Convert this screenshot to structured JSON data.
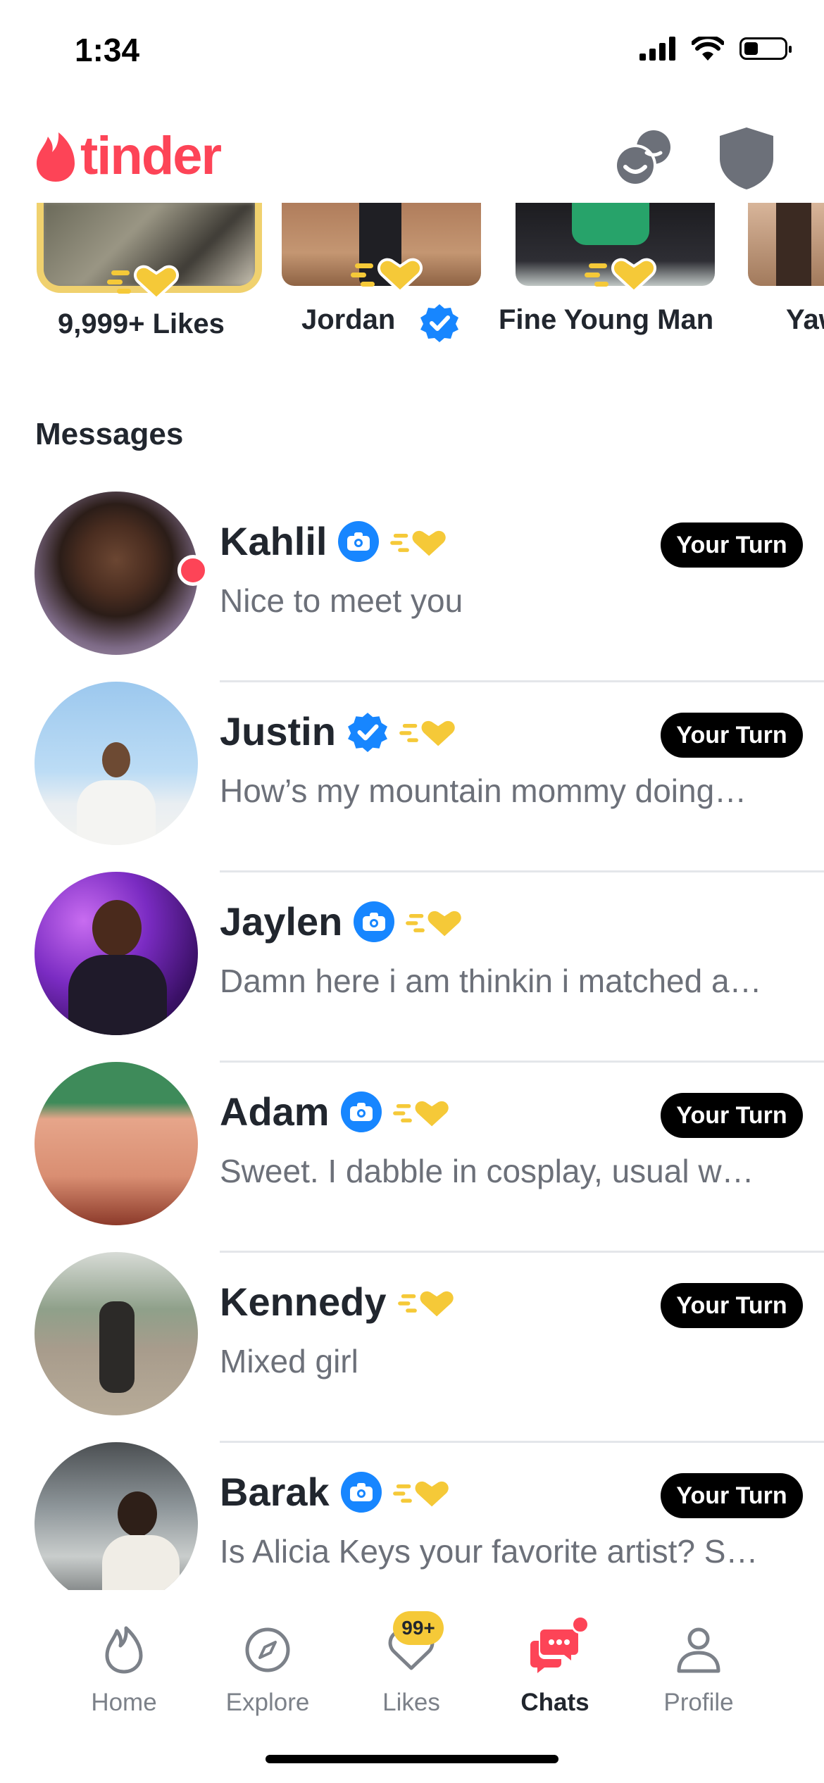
{
  "status_bar": {
    "time": "1:34",
    "battery_level": 0.35
  },
  "app": {
    "logo_text": "tinder",
    "brand_color": "#fd4457",
    "gold_color": "#f5c938"
  },
  "header": {
    "icons": [
      "double-date-icon",
      "safety-shield-icon"
    ]
  },
  "new_matches": [
    {
      "label": "9,999+ Likes",
      "kind": "likes-card"
    },
    {
      "label": "Jordan",
      "verified": true
    },
    {
      "label": "Fine Young Man",
      "verified": false
    },
    {
      "label": "Yaw",
      "verified": false
    }
  ],
  "messages": {
    "title": "Messages",
    "items": [
      {
        "name": "Kahlil",
        "badge": "camera",
        "preview": "Nice to meet you",
        "your_turn": "Your Turn",
        "unread": true
      },
      {
        "name": "Justin",
        "badge": "verified",
        "preview": "How’s my mountain mommy doing…",
        "your_turn": "Your Turn",
        "unread": false
      },
      {
        "name": "Jaylen",
        "badge": "camera",
        "preview": "Damn here i am thinkin i matched a…",
        "your_turn": "",
        "unread": false
      },
      {
        "name": "Adam",
        "badge": "camera",
        "preview": "Sweet. I dabble in cosplay, usual w…",
        "your_turn": "Your Turn",
        "unread": false
      },
      {
        "name": "Kennedy",
        "badge": "",
        "preview": "Mixed girl",
        "your_turn": "Your Turn",
        "unread": false
      },
      {
        "name": "Barak",
        "badge": "camera",
        "preview": "Is Alicia Keys your favorite artist? S…",
        "your_turn": "Your Turn",
        "unread": false
      }
    ]
  },
  "bottom_nav": {
    "items": [
      {
        "label": "Home",
        "icon": "flame-icon",
        "active": false
      },
      {
        "label": "Explore",
        "icon": "compass-icon",
        "active": false
      },
      {
        "label": "Likes",
        "icon": "heart-icon",
        "active": false,
        "count": "99+"
      },
      {
        "label": "Chats",
        "icon": "chat-icon",
        "active": true
      },
      {
        "label": "Profile",
        "icon": "person-icon",
        "active": false
      }
    ]
  }
}
